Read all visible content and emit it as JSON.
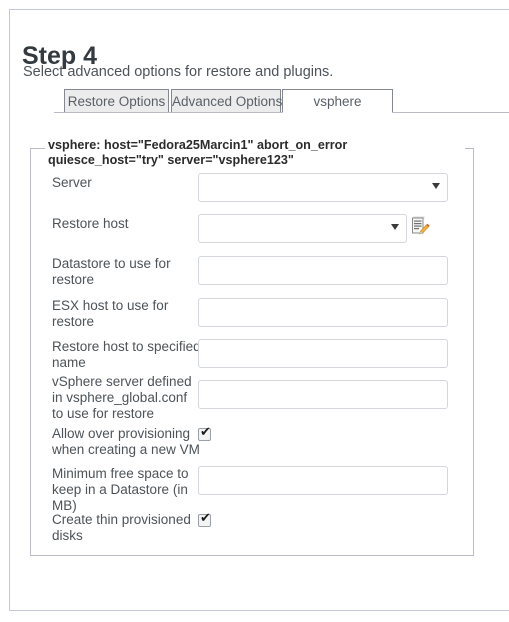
{
  "page": {
    "title": "Step 4",
    "subtitle": "Select advanced options for restore and plugins."
  },
  "tabs": [
    {
      "id": "restore-options",
      "label": "Restore Options",
      "active": false
    },
    {
      "id": "advanced-options",
      "label": "Advanced Options",
      "active": false
    },
    {
      "id": "vsphere",
      "label": "vsphere",
      "active": true
    }
  ],
  "fieldset": {
    "legend": "vsphere: host=\"Fedora25Marcin1\" abort_on_error quiesce_host=\"try\" server=\"vsphere123\""
  },
  "fields": [
    {
      "name": "server",
      "label": "Server",
      "control": "select",
      "value": ""
    },
    {
      "name": "restore-host",
      "label": "Restore host",
      "control": "select",
      "value": "",
      "trailing_icon": "note-edit-icon"
    },
    {
      "name": "datastore",
      "label": "Datastore to use for restore",
      "control": "text",
      "value": ""
    },
    {
      "name": "esx-host",
      "label": "ESX host to use for restore",
      "control": "text",
      "value": ""
    },
    {
      "name": "restore-host-name",
      "label": "Restore host to specified name",
      "control": "text",
      "value": ""
    },
    {
      "name": "vsphere-server-conf",
      "label": "vSphere server defined in vsphere_global.conf to use for restore",
      "control": "text",
      "value": ""
    },
    {
      "name": "allow-over-provision",
      "label": "Allow over provisioning when creating a new VM",
      "control": "checkbox",
      "checked": true,
      "tick": "✔"
    },
    {
      "name": "min-free-space",
      "label": "Minimum free space to keep in a Datastore (in MB)",
      "control": "text",
      "value": ""
    },
    {
      "name": "thin-provisioned",
      "label": "Create thin provisioned disks",
      "control": "checkbox",
      "checked": true,
      "tick": "✔"
    }
  ],
  "colors": {
    "panel_border": "#c5c8d6",
    "fieldset_border": "#b9bcc7",
    "tab_border": "#848792",
    "tab_inactive_bg": "#ececec",
    "tab_active_bg": "#ffffff",
    "input_border": "#d3d6db",
    "text": "#4d5358",
    "title": "#333a40"
  }
}
